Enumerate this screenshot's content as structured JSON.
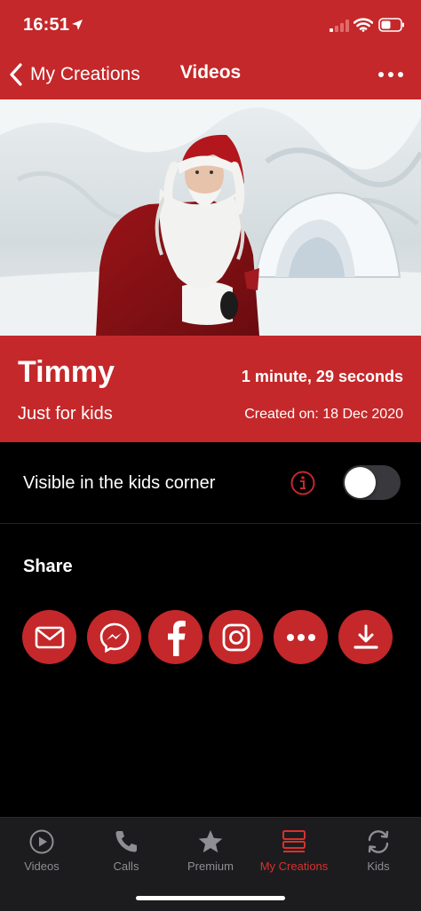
{
  "status_bar": {
    "time": "16:51"
  },
  "nav": {
    "back_label": "My Creations",
    "title": "Videos",
    "more_icon": "more-horizontal-icon"
  },
  "video": {
    "title": "Timmy",
    "subtitle": "Just for kids",
    "duration": "1 minute, 29 seconds",
    "created": "Created on: 18 Dec 2020"
  },
  "kids_corner": {
    "label": "Visible in the kids corner",
    "enabled": false
  },
  "share": {
    "title": "Share",
    "options": [
      "email-icon",
      "messenger-icon",
      "facebook-icon",
      "instagram-icon",
      "more-icon",
      "download-icon"
    ]
  },
  "tabs": [
    {
      "label": "Videos",
      "icon": "play-circle-icon",
      "active": false
    },
    {
      "label": "Calls",
      "icon": "phone-icon",
      "active": false
    },
    {
      "label": "Premium",
      "icon": "star-icon",
      "active": false
    },
    {
      "label": "My Creations",
      "icon": "creations-icon",
      "active": true
    },
    {
      "label": "Kids",
      "icon": "refresh-icon",
      "active": false
    }
  ],
  "colors": {
    "brand_red": "#c4282a",
    "active_tab": "#d9302c",
    "background": "#000000"
  }
}
